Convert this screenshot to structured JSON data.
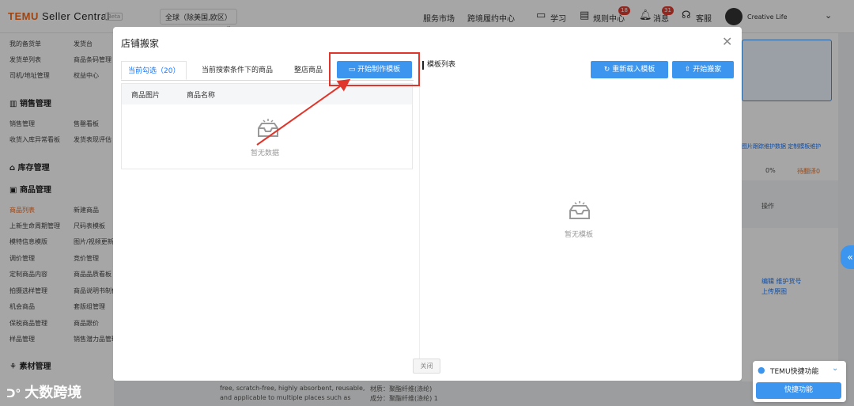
{
  "header": {
    "logo_brand": "TEMU",
    "logo_suffix": " Seller Central",
    "beta": "Beta",
    "region": "全球（除美国,欧区）",
    "links": [
      "服务市场",
      "跨境履约中心"
    ],
    "study": "学习",
    "rules": "规则中心",
    "rules_badge": "18",
    "messages": "消息",
    "messages_badge": "31",
    "service": "客服",
    "shop_name": "Creative Life"
  },
  "sidebar": {
    "top_items": [
      [
        "我的备货单",
        "发货台"
      ],
      [
        "发货单列表",
        "商品条码管理"
      ],
      [
        "司机/地址管理",
        "权益中心"
      ]
    ],
    "sales_title": "销售管理",
    "sales_items": [
      [
        "销售管理",
        "售罄看板"
      ],
      [
        "收货入库异常看板",
        "发货表现评估"
      ]
    ],
    "inventory_title": "库存管理",
    "product_title": "商品管理",
    "product_items": [
      [
        "商品列表",
        "新建商品"
      ],
      [
        "上新生命周期管理",
        "尺码表模板"
      ],
      [
        "模特信息模版",
        "图片/视频更新"
      ],
      [
        "调价管理",
        "竞价管理"
      ],
      [
        "定制商品内容",
        "商品品质看板"
      ],
      [
        "拍摄选样管理",
        "商品说明书制作"
      ],
      [
        "机会商品",
        "套版组管理"
      ],
      [
        "保税商品管理",
        "商品跟价"
      ],
      [
        "样品管理",
        "销售潜力品管理"
      ]
    ],
    "material_title": "素材管理"
  },
  "background": {
    "right_links": "图片跟踪维护数据  定制模板维护",
    "progress": "0%",
    "warning": "待翻译0",
    "operation": "操作",
    "actions": "编辑  维护货号",
    "actions2": "上传原图",
    "bottom_text1": "free, scratch-free, highly absorbent, reusable,",
    "bottom_text2": "and applicable to multiple places such as",
    "bottom_text3": "材质：聚酯纤维(涤纶)",
    "bottom_text4": "成分：聚酯纤维(涤纶) 1"
  },
  "modal": {
    "title": "店铺搬家",
    "tabs": [
      "当前勾选（20）",
      "当前搜索条件下的商品",
      "整店商品"
    ],
    "start_template_btn": "开始制作模板",
    "table_headers": [
      "商品图片",
      "商品名称"
    ],
    "empty_text": "暂无数据",
    "template_list_title": "模板列表",
    "reload_btn": "重新载入模板",
    "start_move_btn": "开始搬家",
    "empty_template_text": "暂无模板",
    "close_btn": "关闭"
  },
  "quick": {
    "title": "TEMU快捷功能",
    "button": "快捷功能"
  },
  "watermark": "大数跨境",
  "colors": {
    "primary": "#3c96f0",
    "highlight": "#e0352b",
    "brand": "#f56b1c"
  }
}
